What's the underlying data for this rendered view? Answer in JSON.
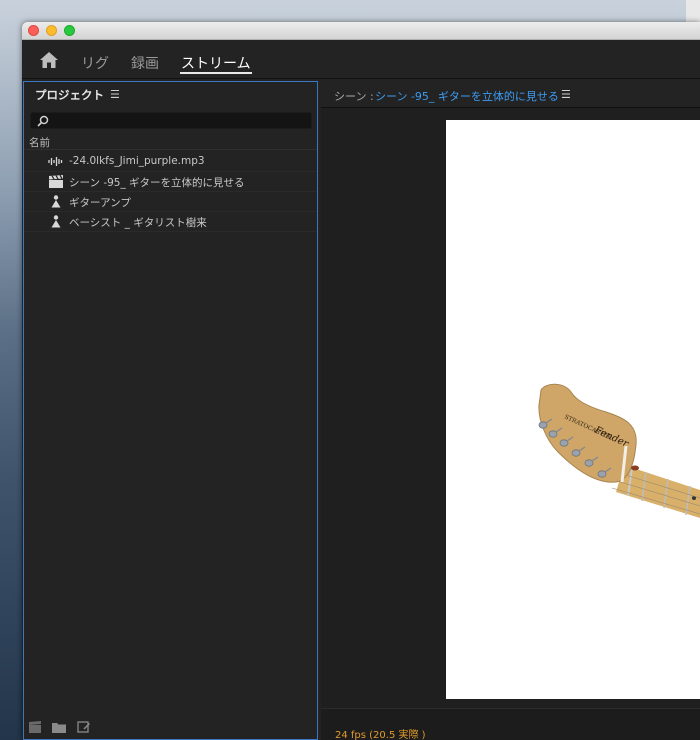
{
  "workspace": {
    "tabs": [
      {
        "label": "リグ"
      },
      {
        "label": "録画"
      },
      {
        "label": "ストリーム"
      }
    ]
  },
  "project": {
    "title": "プロジェクト",
    "search": {
      "value": "",
      "placeholder": ""
    },
    "column_header": "名前",
    "items": [
      {
        "label": "-24.0lkfs_Jimi_purple.mp3",
        "icon": "audio-waveform-icon"
      },
      {
        "label": "シーン -95_ ギターを立体的に見せる",
        "icon": "clapperboard-icon"
      },
      {
        "label": "ギターアンプ",
        "icon": "puppet-icon"
      },
      {
        "label": "ベーシスト _ ギタリスト樹来",
        "icon": "puppet-icon"
      }
    ]
  },
  "program": {
    "prefix": "シーン :",
    "scene_name": "シーン -95_ ギターを立体的に見せる",
    "fps": "24 fps (20.5 実際 )"
  },
  "colors": {
    "accent": "#3d9bf2",
    "fps": "#e09a2c",
    "panel_border": "#3b77c2"
  }
}
